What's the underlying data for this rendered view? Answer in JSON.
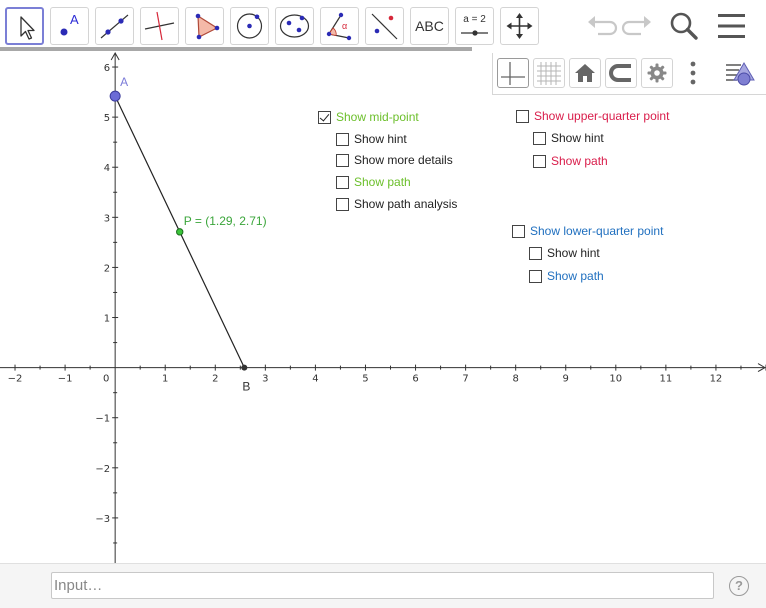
{
  "toolbar": {
    "tools": [
      {
        "name": "move-tool",
        "label": ""
      },
      {
        "name": "point-tool",
        "label": "A"
      },
      {
        "name": "line-tool",
        "label": ""
      },
      {
        "name": "perpendicular-line-tool",
        "label": ""
      },
      {
        "name": "polygon-tool",
        "label": ""
      },
      {
        "name": "circle-tool",
        "label": ""
      },
      {
        "name": "ellipse-tool",
        "label": ""
      },
      {
        "name": "angle-tool",
        "label": "α"
      },
      {
        "name": "reflect-tool",
        "label": ""
      },
      {
        "name": "text-tool",
        "label": "ABC"
      },
      {
        "name": "slider-tool",
        "label": "a = 2"
      },
      {
        "name": "move-graphics-tool",
        "label": ""
      }
    ],
    "right_icons": [
      "undo-icon",
      "redo-icon",
      "search-icon",
      "menu-icon"
    ]
  },
  "stylebar": {
    "buttons": [
      "axes-icon",
      "grid-icon",
      "home-icon",
      "point-capture-icon",
      "settings-icon",
      "more-vertical-icon",
      "style-bar-toggle-icon"
    ]
  },
  "graph": {
    "x_range": [
      -2.3,
      13
    ],
    "y_range": [
      -3.9,
      6.3
    ],
    "x_ticks": [
      -2,
      -1,
      0,
      1,
      2,
      3,
      4,
      5,
      6,
      7,
      8,
      9,
      10,
      11,
      12
    ],
    "y_ticks": [
      -3,
      -2,
      -1,
      1,
      2,
      3,
      4,
      5,
      6
    ],
    "points": {
      "A": {
        "label": "A",
        "x": 0,
        "y": 5.42
      },
      "B": {
        "label": "B",
        "x": 2.58,
        "y": 0
      },
      "P": {
        "label": "P = (1.29, 2.71)",
        "x": 1.29,
        "y": 2.71
      }
    },
    "colors": {
      "A": "#6b6bd6",
      "A_label": "#7b7bd8",
      "P": "#3bc43b",
      "P_label": "#3aa53a",
      "B": "#333333",
      "segment": "#222222"
    }
  },
  "checkboxes": {
    "mid": {
      "main": {
        "label": "Show mid-point",
        "checked": true,
        "color": "#6bbf2a"
      },
      "hint": {
        "label": "Show hint",
        "checked": false,
        "color": "#222222"
      },
      "details": {
        "label": "Show more details",
        "checked": false,
        "color": "#222222"
      },
      "path": {
        "label": "Show path",
        "checked": false,
        "color": "#6bbf2a"
      },
      "analysis": {
        "label": "Show path analysis",
        "checked": false,
        "color": "#222222"
      }
    },
    "upper": {
      "main": {
        "label": "Show upper-quarter point",
        "checked": false,
        "color": "#d91c4a"
      },
      "hint": {
        "label": "Show hint",
        "checked": false,
        "color": "#222222"
      },
      "path": {
        "label": "Show path",
        "checked": false,
        "color": "#d91c4a"
      }
    },
    "lower": {
      "main": {
        "label": "Show lower-quarter point",
        "checked": false,
        "color": "#1f6fbf"
      },
      "hint": {
        "label": "Show hint",
        "checked": false,
        "color": "#222222"
      },
      "path": {
        "label": "Show path",
        "checked": false,
        "color": "#1f6fbf"
      }
    }
  },
  "input": {
    "placeholder": "Input…",
    "help_label": "?"
  }
}
